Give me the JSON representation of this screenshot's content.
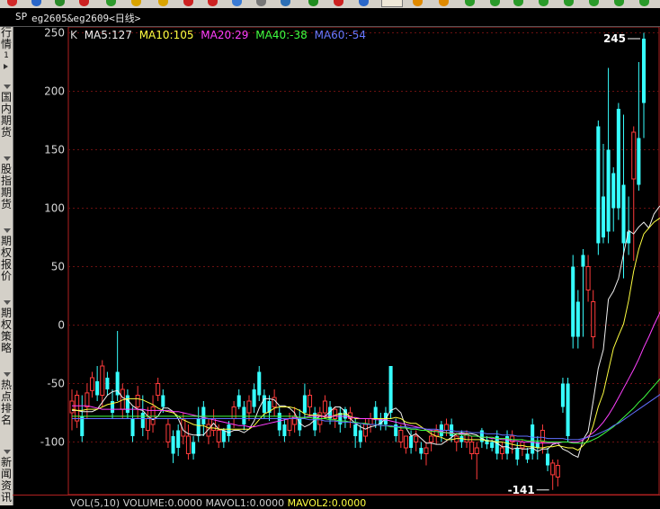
{
  "title_bar": {
    "symbol_label": "SP",
    "contract": "eg2605&eg2609<日线>"
  },
  "sidebar": {
    "tabs": [
      {
        "label": "行情",
        "sub": "1"
      },
      {
        "label": "国内期货"
      },
      {
        "label": "股指期货"
      },
      {
        "label": "期权报价"
      },
      {
        "label": "期权策略"
      },
      {
        "label": "热点排名"
      },
      {
        "label": "新闻资讯"
      }
    ]
  },
  "indicators": {
    "k": "K",
    "ma5": "MA5:127",
    "ma10": "MA10:105",
    "ma20": "MA20:29",
    "ma40": "MA40:-38",
    "ma60": "MA60:-54"
  },
  "volume_bar": {
    "vol": "VOL(5,10)",
    "volume": "VOLUME:0.0000",
    "mavol1": "MAVOL1:0.0000",
    "mavol2": "MAVOL2:0.0000"
  },
  "colors": {
    "up": "#ff3b3b",
    "down": "#36ffff",
    "ma5": "#f0f0f0",
    "ma10": "#ffff40",
    "ma20": "#ff40ff",
    "ma40": "#40ff40",
    "ma60": "#6070ff",
    "axis": "#b02020"
  },
  "chart_data": {
    "type": "candlestick",
    "y_ticks": [
      -100,
      -50,
      0,
      50,
      100,
      150,
      200,
      250
    ],
    "ylim": [
      -145,
      255
    ],
    "grid": true,
    "annotations": [
      {
        "label": "245",
        "value": 245
      },
      {
        "label": "-141",
        "value": -141
      }
    ],
    "candles": [
      [
        -75,
        -65,
        -90,
        -55
      ],
      [
        -82,
        -60,
        -88,
        -56
      ],
      [
        -78,
        -95,
        -100,
        -60
      ],
      [
        -70,
        -58,
        -80,
        -50
      ],
      [
        -56,
        -45,
        -62,
        -40
      ],
      [
        -48,
        -60,
        -65,
        -35
      ],
      [
        -60,
        -35,
        -70,
        -30
      ],
      [
        -45,
        -55,
        -60,
        -40
      ],
      [
        -65,
        -75,
        -80,
        -55
      ],
      [
        -40,
        -60,
        -65,
        -5
      ],
      [
        -72,
        -55,
        -80,
        -50
      ],
      [
        -60,
        -75,
        -80,
        -55
      ],
      [
        -80,
        -95,
        -100,
        -70
      ],
      [
        -70,
        -60,
        -80,
        -52
      ],
      [
        -75,
        -88,
        -95,
        -60
      ],
      [
        -90,
        -80,
        -98,
        -70
      ],
      [
        -85,
        -70,
        -92,
        -60
      ],
      [
        -60,
        -50,
        -65,
        -45
      ],
      [
        -60,
        -70,
        -75,
        -55
      ],
      [
        -100,
        -85,
        -105,
        -80
      ],
      [
        -95,
        -110,
        -118,
        -90
      ],
      [
        -90,
        -105,
        -112,
        -85
      ],
      [
        -95,
        -80,
        -102,
        -75
      ],
      [
        -110,
        -95,
        -115,
        -85
      ],
      [
        -100,
        -110,
        -115,
        -95
      ],
      [
        -80,
        -95,
        -100,
        -70
      ],
      [
        -70,
        -85,
        -95,
        -65
      ],
      [
        -95,
        -85,
        -102,
        -80
      ],
      [
        -90,
        -80,
        -95,
        -72
      ],
      [
        -100,
        -90,
        -105,
        -85
      ],
      [
        -90,
        -100,
        -105,
        -88
      ],
      [
        -85,
        -95,
        -100,
        -82
      ],
      [
        -80,
        -70,
        -88,
        -65
      ],
      [
        -60,
        -70,
        -72,
        -55
      ],
      [
        -70,
        -85,
        -90,
        -65
      ],
      [
        -75,
        -65,
        -82,
        -60
      ],
      [
        -55,
        -70,
        -75,
        -50
      ],
      [
        -40,
        -60,
        -65,
        -35
      ],
      [
        -60,
        -75,
        -80,
        -55
      ],
      [
        -65,
        -75,
        -82,
        -60
      ],
      [
        -70,
        -62,
        -78,
        -55
      ],
      [
        -75,
        -90,
        -95,
        -70
      ],
      [
        -85,
        -95,
        -100,
        -80
      ],
      [
        -90,
        -80,
        -95,
        -75
      ],
      [
        -85,
        -78,
        -92,
        -70
      ],
      [
        -80,
        -90,
        -95,
        -72
      ],
      [
        -60,
        -75,
        -80,
        -50
      ],
      [
        -70,
        -60,
        -78,
        -55
      ],
      [
        -75,
        -90,
        -95,
        -70
      ],
      [
        -85,
        -75,
        -92,
        -70
      ],
      [
        -75,
        -65,
        -80,
        -60
      ],
      [
        -70,
        -80,
        -85,
        -65
      ],
      [
        -80,
        -72,
        -88,
        -70
      ],
      [
        -75,
        -85,
        -92,
        -70
      ],
      [
        -72,
        -80,
        -88,
        -70
      ],
      [
        -80,
        -75,
        -88,
        -70
      ],
      [
        -85,
        -95,
        -105,
        -80
      ],
      [
        -90,
        -100,
        -105,
        -85
      ],
      [
        -95,
        -85,
        -100,
        -80
      ],
      [
        -85,
        -80,
        -92,
        -75
      ],
      [
        -70,
        -80,
        -88,
        -65
      ],
      [
        -80,
        -85,
        -90,
        -75
      ],
      [
        -75,
        -85,
        -90,
        -70
      ],
      [
        -35,
        -75,
        -80,
        -35
      ],
      [
        -85,
        -95,
        -100,
        -80
      ],
      [
        -100,
        -90,
        -105,
        -85
      ],
      [
        -105,
        -95,
        -110,
        -95
      ],
      [
        -95,
        -105,
        -110,
        -90
      ],
      [
        -100,
        -95,
        -108,
        -90
      ],
      [
        -105,
        -110,
        -115,
        -100
      ],
      [
        -110,
        -105,
        -120,
        -100
      ],
      [
        -100,
        -95,
        -108,
        -90
      ],
      [
        -95,
        -90,
        -102,
        -85
      ],
      [
        -85,
        -95,
        -100,
        -82
      ],
      [
        -90,
        -85,
        -95,
        -80
      ],
      [
        -85,
        -95,
        -100,
        -80
      ],
      [
        -100,
        -95,
        -108,
        -92
      ],
      [
        -95,
        -100,
        -105,
        -90
      ],
      [
        -100,
        -93,
        -105,
        -90
      ],
      [
        -110,
        -100,
        -115,
        -95
      ],
      [
        -110,
        -105,
        -132,
        -100
      ],
      [
        -90,
        -100,
        -105,
        -88
      ],
      [
        -98,
        -102,
        -106,
        -95
      ],
      [
        -100,
        -105,
        -108,
        -98
      ],
      [
        -95,
        -110,
        -115,
        -90
      ],
      [
        -110,
        -105,
        -115,
        -100
      ],
      [
        -95,
        -110,
        -115,
        -90
      ],
      [
        -100,
        -95,
        -110,
        -90
      ],
      [
        -105,
        -115,
        -120,
        -100
      ],
      [
        -105,
        -100,
        -112,
        -98
      ],
      [
        -110,
        -115,
        -118,
        -105
      ],
      [
        -85,
        -110,
        -115,
        -80
      ],
      [
        -100,
        -105,
        -115,
        -95
      ],
      [
        -100,
        -90,
        -110,
        -85
      ],
      [
        -110,
        -120,
        -125,
        -105
      ],
      [
        -128,
        -118,
        -141,
        -115
      ],
      [
        -130,
        -120,
        -138,
        -115
      ],
      [
        -50,
        -70,
        -75,
        -45
      ],
      [
        -50,
        -95,
        -100,
        -45
      ],
      [
        50,
        -10,
        -20,
        60
      ],
      [
        20,
        -10,
        -20,
        30
      ],
      [
        60,
        50,
        -10,
        65
      ],
      [
        30,
        50,
        20,
        60
      ],
      [
        -10,
        20,
        -20,
        30
      ],
      [
        170,
        70,
        60,
        175
      ],
      [
        110,
        75,
        70,
        155
      ],
      [
        150,
        80,
        70,
        220
      ],
      [
        130,
        100,
        80,
        135
      ],
      [
        185,
        100,
        90,
        190
      ],
      [
        120,
        70,
        40,
        180
      ],
      [
        80,
        70,
        60,
        110
      ],
      [
        125,
        165,
        55,
        170
      ],
      [
        160,
        120,
        115,
        225
      ],
      [
        245,
        190,
        160,
        250
      ]
    ],
    "ma_lines": [
      {
        "name": "MA5",
        "values": [
          -73,
          -73,
          -74,
          -74,
          -74,
          -72,
          -66,
          -60,
          -57,
          -56,
          -62,
          -64,
          -69,
          -72,
          -73,
          -78,
          -81,
          -78,
          -71,
          -71,
          -74,
          -80,
          -90,
          -93,
          -94,
          -94,
          -94,
          -89,
          -84,
          -89,
          -90,
          -92,
          -90,
          -90,
          -92,
          -89,
          -82,
          -71,
          -63,
          -63,
          -64,
          -69,
          -69,
          -71,
          -75,
          -84,
          -87,
          -85,
          -81,
          -78,
          -78,
          -74,
          -70,
          -70,
          -74,
          -80,
          -84,
          -87,
          -89,
          -87,
          -86,
          -84,
          -80,
          -73,
          -71,
          -75,
          -88,
          -95,
          -93,
          -97,
          -101,
          -101,
          -102,
          -102,
          -99,
          -96,
          -93,
          -92,
          -93,
          -93,
          -94,
          -97,
          -99,
          -99,
          -101,
          -104,
          -104,
          -106,
          -105,
          -106,
          -106,
          -105,
          -108,
          -106,
          -106,
          -102,
          -101,
          -106,
          -108,
          -111,
          -113,
          -98,
          -91,
          -65,
          -37,
          -21,
          22,
          29,
          40,
          61,
          81,
          78,
          84,
          88,
          83,
          95,
          101,
          105,
          127
        ]
      },
      {
        "name": "MA10",
        "values": [
          -72,
          -73,
          -73,
          -72,
          -72,
          -72,
          -70,
          -68,
          -67,
          -66,
          -64,
          -63,
          -63,
          -63,
          -64,
          -66,
          -68,
          -71,
          -73,
          -74,
          -75,
          -78,
          -81,
          -83,
          -85,
          -86,
          -86,
          -88,
          -88,
          -89,
          -89,
          -89,
          -89,
          -89,
          -89,
          -89,
          -86,
          -81,
          -76,
          -74,
          -71,
          -70,
          -70,
          -70,
          -71,
          -73,
          -76,
          -77,
          -77,
          -77,
          -79,
          -79,
          -77,
          -76,
          -76,
          -78,
          -80,
          -80,
          -80,
          -80,
          -80,
          -80,
          -80,
          -80,
          -79,
          -80,
          -83,
          -84,
          -84,
          -87,
          -90,
          -93,
          -95,
          -96,
          -98,
          -98,
          -97,
          -97,
          -98,
          -98,
          -98,
          -98,
          -99,
          -99,
          -100,
          -100,
          -101,
          -102,
          -103,
          -103,
          -104,
          -104,
          -105,
          -105,
          -104,
          -104,
          -103,
          -104,
          -105,
          -105,
          -107,
          -103,
          -98,
          -86,
          -70,
          -58,
          -39,
          -20,
          -9,
          1,
          21,
          46,
          65,
          78,
          83,
          88,
          91,
          94,
          105
        ]
      },
      {
        "name": "MA20",
        "values": [
          -69,
          -69,
          -69,
          -69,
          -70,
          -71,
          -72,
          -72,
          -72,
          -72,
          -72,
          -72,
          -72,
          -72,
          -72,
          -73,
          -73,
          -73,
          -73,
          -73,
          -74,
          -74,
          -75,
          -76,
          -77,
          -78,
          -79,
          -80,
          -81,
          -82,
          -83,
          -84,
          -85,
          -86,
          -86,
          -87,
          -87,
          -86,
          -85,
          -84,
          -83,
          -82,
          -81,
          -80,
          -79,
          -79,
          -79,
          -78,
          -78,
          -78,
          -78,
          -78,
          -78,
          -78,
          -78,
          -79,
          -79,
          -80,
          -80,
          -80,
          -81,
          -81,
          -81,
          -82,
          -83,
          -84,
          -85,
          -86,
          -87,
          -88,
          -89,
          -90,
          -91,
          -91,
          -92,
          -92,
          -93,
          -93,
          -94,
          -95,
          -95,
          -96,
          -96,
          -97,
          -97,
          -98,
          -98,
          -99,
          -99,
          -100,
          -100,
          -100,
          -101,
          -101,
          -101,
          -101,
          -101,
          -100,
          -100,
          -100,
          -100,
          -98,
          -95,
          -92,
          -88,
          -83,
          -77,
          -70,
          -62,
          -54,
          -46,
          -38,
          -29,
          -19,
          -10,
          0,
          9,
          19,
          29
        ]
      },
      {
        "name": "MA40",
        "values": [
          -78,
          -78,
          -78,
          -78,
          -78,
          -78,
          -78,
          -78,
          -78,
          -78,
          -78,
          -78,
          -78,
          -78,
          -78,
          -78,
          -78,
          -78,
          -78,
          -78,
          -78,
          -78,
          -78,
          -78,
          -78,
          -78,
          -78,
          -78,
          -78,
          -78,
          -78,
          -78,
          -78,
          -78,
          -78,
          -78,
          -78,
          -78,
          -78,
          -78,
          -78,
          -78,
          -78,
          -78,
          -78,
          -79,
          -79,
          -79,
          -80,
          -80,
          -80,
          -81,
          -81,
          -82,
          -82,
          -83,
          -83,
          -84,
          -84,
          -85,
          -85,
          -86,
          -86,
          -87,
          -87,
          -88,
          -88,
          -89,
          -89,
          -90,
          -90,
          -91,
          -91,
          -92,
          -92,
          -93,
          -93,
          -94,
          -94,
          -95,
          -95,
          -96,
          -96,
          -96,
          -97,
          -97,
          -97,
          -98,
          -98,
          -98,
          -99,
          -99,
          -99,
          -99,
          -100,
          -100,
          -100,
          -100,
          -100,
          -101,
          -101,
          -101,
          -100,
          -98,
          -96,
          -93,
          -90,
          -87,
          -83,
          -79,
          -75,
          -71,
          -66,
          -62,
          -57,
          -52,
          -47,
          -43,
          -38
        ]
      },
      {
        "name": "MA60",
        "values": [
          -80,
          -80,
          -80,
          -80,
          -80,
          -80,
          -80,
          -80,
          -80,
          -80,
          -80,
          -80,
          -80,
          -80,
          -80,
          -80,
          -80,
          -80,
          -80,
          -80,
          -80,
          -80,
          -80,
          -80,
          -80,
          -80,
          -80,
          -80,
          -80,
          -80,
          -80,
          -80,
          -80,
          -80,
          -80,
          -80,
          -80,
          -80,
          -80,
          -80,
          -80,
          -80,
          -80,
          -80,
          -80,
          -80,
          -80,
          -81,
          -81,
          -81,
          -82,
          -82,
          -82,
          -83,
          -83,
          -83,
          -84,
          -84,
          -85,
          -85,
          -85,
          -86,
          -86,
          -86,
          -87,
          -87,
          -87,
          -88,
          -88,
          -88,
          -89,
          -89,
          -89,
          -90,
          -90,
          -90,
          -91,
          -91,
          -91,
          -92,
          -92,
          -92,
          -93,
          -93,
          -93,
          -94,
          -94,
          -94,
          -95,
          -95,
          -95,
          -96,
          -96,
          -96,
          -97,
          -97,
          -97,
          -97,
          -98,
          -98,
          -98,
          -97,
          -96,
          -95,
          -93,
          -91,
          -89,
          -86,
          -84,
          -81,
          -78,
          -75,
          -72,
          -69,
          -66,
          -63,
          -60,
          -57,
          -54
        ]
      }
    ]
  }
}
